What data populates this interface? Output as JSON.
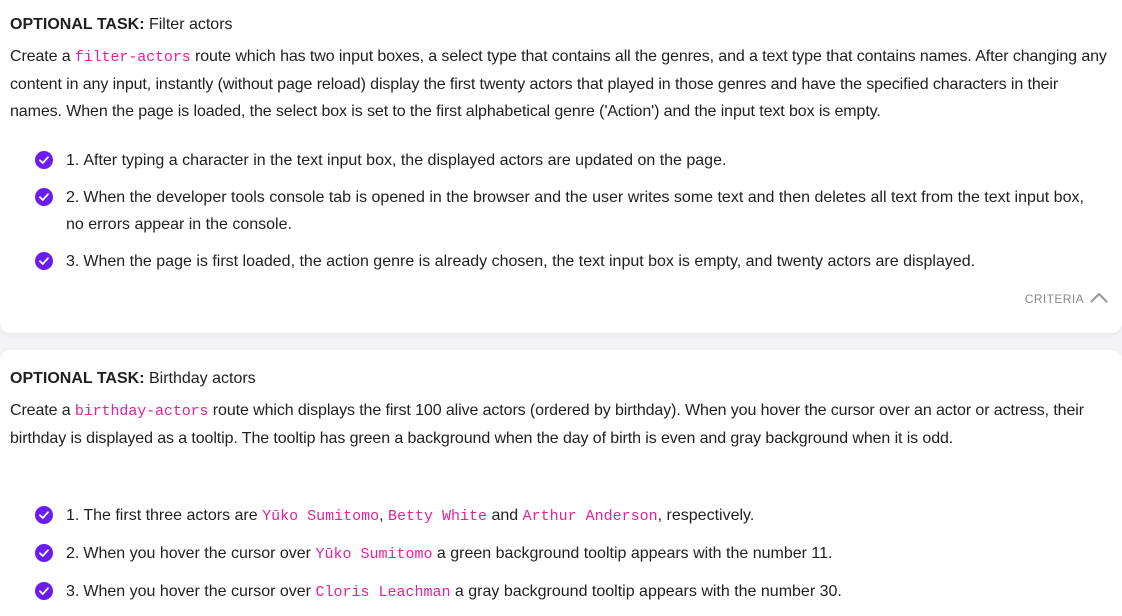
{
  "colors": {
    "accent": "#6a1cf2",
    "code": "#e3219a",
    "muted": "#8a8a8a"
  },
  "tasks": [
    {
      "label": "OPTIONAL TASK:",
      "title": " Filter actors",
      "desc_parts": [
        "Create a ",
        "filter-actors",
        " route which has two input boxes, a select type that contains all the genres, and a text type that contains names. After changing any content in any input, instantly (without page reload) display the first twenty actors that played in those genres and have the specified characters in their names. When the page is loaded, the select box is set to the first alphabetical genre ('Action') and the input text box is empty."
      ],
      "criteria": [
        {
          "num": "1.",
          "text": "After typing a character in the text input box, the displayed actors are updated on the page."
        },
        {
          "num": "2.",
          "text": "When the developer tools console tab is opened in the browser and the user writes some text and then deletes all text from the text input box, no errors appear in the console."
        },
        {
          "num": "3.",
          "text": "When the page is first loaded, the action genre is already chosen, the text input box is empty, and twenty actors are displayed."
        }
      ],
      "criteria_toggle": "CRITERIA"
    },
    {
      "label": "OPTIONAL TASK:",
      "title": " Birthday actors",
      "desc_parts": [
        "Create a ",
        "birthday-actors",
        " route which displays the first 100 alive actors (ordered by birthday). When you hover the cursor over an actor or actress, their birthday is displayed as a tooltip. The tooltip has green a background when the day of birth is even and gray background when it is odd."
      ],
      "criteria": [
        {
          "num": "1.",
          "p1": "The first three actors are ",
          "c1": "Yūko Sumitomo",
          "p2": ", ",
          "c2": "Betty White",
          "p3": " and ",
          "c3": "Arthur Anderson",
          "p4": ", respectively."
        },
        {
          "num": "2.",
          "p1": "When you hover the cursor over ",
          "c1": "Yūko Sumitomo",
          "p2": " a green background tooltip appears with the number 11."
        },
        {
          "num": "3.",
          "p1": "When you hover the cursor over ",
          "c1": "Cloris Leachman",
          "p2": " a gray background tooltip appears with the number 30."
        }
      ]
    }
  ]
}
